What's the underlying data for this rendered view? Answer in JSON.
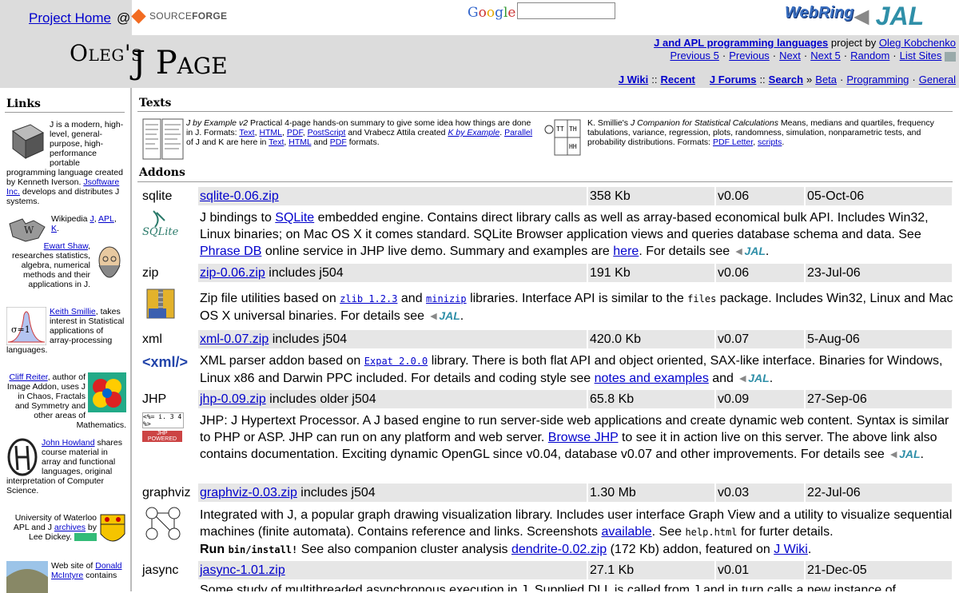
{
  "header": {
    "project_home": "Project Home",
    "at": "@",
    "sf_a": "SOURCE",
    "sf_b": "FORGE",
    "google": "Google",
    "webring": "WebRing",
    "jal": "JAL",
    "title_a": "Oleg's",
    "title_b": "J Page",
    "sub_link": "J and APL programming languages",
    "sub_text": " project by ",
    "sub_author": "Oleg Kobchenko",
    "nav": [
      "Previous 5",
      "Previous",
      "Next",
      "Next 5",
      "Random",
      "List Sites"
    ],
    "wiki": [
      "J Wiki",
      "Recent",
      "J Forums",
      "Search",
      "Beta",
      "Programming",
      "General"
    ],
    "wiki_seps": [
      "::",
      "»"
    ]
  },
  "sidebar": {
    "heading": "Links",
    "b1": {
      "text": "J is a modern, high-level, general-purpose, high-performance portable programming language created by Kenneth Iverson. ",
      "link": "Jsoftware Inc.",
      "tail": " develops and distributes J systems."
    },
    "b2": {
      "pre": "Wikipedia ",
      "l1": "J",
      "l2": "APL",
      "l3": "K",
      "sep": ", ",
      "end": "."
    },
    "b3": {
      "link": "Ewart Shaw",
      "text": ", researches statistics, algebra, numerical methods and their applications in J."
    },
    "b4": {
      "link": "Keith Smillie",
      "text": ", takes interest in Statistical applications of array-processing languages."
    },
    "b5": {
      "link": "Cliff Reiter",
      "text": ", author of Image Addon, uses J in Chaos, Fractals and Symmetry and other areas of Mathematics."
    },
    "b6": {
      "link": "John Howland",
      "text": " shares course material in array and functional languages, original interpretation of Computer Science."
    },
    "b7": {
      "text": "University of Waterloo APL and J ",
      "link": "archives",
      "tail": " by Lee Dickey."
    },
    "b8": {
      "text": "Web site of ",
      "link": "Donald McIntyre",
      "tail": " contains"
    }
  },
  "texts": {
    "heading": "Texts",
    "t1": {
      "title": "J by Example v2",
      "body": " Practical 4-page hands-on summary to give some idea how things are done in J. Formats: ",
      "f1": "Text",
      "f2": "HTML",
      "f3": "PDF",
      "f4": "PostScript",
      "mid": " and Vrabecz Attila created ",
      "kex": "K by Example",
      "par": "Parallel",
      "mid2": " of J and K are here in ",
      "g1": "Text",
      "g2": "HTML",
      "and": " and ",
      "g3": "PDF",
      "end": " formats."
    },
    "t2": {
      "pre": "K. Smillie's ",
      "title": "J Companion for Statistical Calculations",
      "body": " Means, medians and quartiles, frequency tabulations, variance, regression, plots, randomness, simulation, nonparametric tests, and probability distributions. Formats: ",
      "f1": "PDF Letter",
      "f2": "scripts",
      "end": "."
    }
  },
  "addons": {
    "heading": "Addons",
    "rows": [
      {
        "name": "sqlite",
        "file": "sqlite-0.06.zip",
        "extra": "",
        "size": "358 Kb",
        "ver": "v0.06",
        "date": "05-Oct-06"
      },
      {
        "name": "zip",
        "file": "zip-0.06.zip",
        "extra": " includes j504",
        "size": "191 Kb",
        "ver": "v0.06",
        "date": "23-Jul-06"
      },
      {
        "name": "xml",
        "file": "xml-0.07.zip",
        "extra": " includes j504",
        "size": "420.0 Kb",
        "ver": "v0.07",
        "date": "5-Aug-06"
      },
      {
        "name": "JHP",
        "file": "jhp-0.09.zip",
        "extra": " includes older j504",
        "size": "65.8 Kb",
        "ver": "v0.09",
        "date": "27-Sep-06"
      },
      {
        "name": "graphviz",
        "file": "graphviz-0.03.zip",
        "extra": " includes j504",
        "size": "1.30 Mb",
        "ver": "v0.03",
        "date": "22-Jul-06"
      },
      {
        "name": "jasync",
        "file": "jasync-1.01.zip",
        "extra": "",
        "size": "27.1 Kb",
        "ver": "v0.01",
        "date": "21-Dec-05"
      }
    ],
    "d_sqlite": {
      "a": "J bindings to ",
      "l1": "SQLite",
      "b": " embedded engine. Contains direct library calls as well as array-based economical bulk API. Includes Win32, Linux binaries; on Mac OS X it comes standard. SQLite Browser application views and queries database schema and data. See ",
      "l2": "Phrase DB",
      "c": " online service in JHP live demo. Summary and examples are ",
      "l3": "here",
      "d": ". For details see "
    },
    "d_zip": {
      "a": "Zip file utilities based on ",
      "l1": "zlib 1.2.3",
      "b": " and ",
      "l2": "minizip",
      "c": " libraries. Interface API is similar to the ",
      "code": "files",
      "d": " package. Includes Win32, Linux and Mac OS X universal binaries. For details see "
    },
    "d_xml": {
      "a": "XML parser addon based on ",
      "l1": "Expat 2.0.0",
      "b": " library. There is both flat API and object oriented, SAX-like interface. Binaries for Windows, Linux x86 and Darwin PPC included. For details and coding style see ",
      "l2": "notes and examples",
      "c": " and "
    },
    "d_jhp": {
      "a": "JHP: J Hypertext Processor. A J based engine to run server-side web applications and create dynamic web content. Syntax is similar to PHP or ASP. JHP can run on any platform and web server. ",
      "l1": "Browse JHP",
      "b": " to see it in action live on this server. The above link also contains documentation. Exciting dynamic OpenGL since v0.04, database v0.07 and other improvements. For details see "
    },
    "d_gv": {
      "a": "Integrated with J, a popular graph drawing visualization library. Includes user interface Graph View and a utility to visualize sequential machines (finite automata). Contains reference and links. Screenshots ",
      "l1": "available",
      "b": ". See ",
      "code": "help.html",
      "c": " for furter details.",
      "run": "Run",
      "code2": "bin/install!",
      "d": " See also companion cluster analysis ",
      "l2": "dendrite-0.02.zip",
      "e": " (172 Kb) addon, featured on ",
      "l3": "J Wiki",
      "f": "."
    },
    "d_jasync": {
      "a": "Some study of multithreaded asynchronous execution in J. Supplied DLL is called from J and in turn calls a new instance of"
    },
    "jhp_badge": "JHP POWERED",
    "jhp_snip": "<%= i. 3 4 %>",
    "xml_logo": "<xml/>",
    "sqlite_logo": "SQLite"
  },
  "colors": {
    "link": "#0000cc",
    "band": "#dcdcdc",
    "cell": "#e6e6e6",
    "jal": "#2f8fa8"
  }
}
